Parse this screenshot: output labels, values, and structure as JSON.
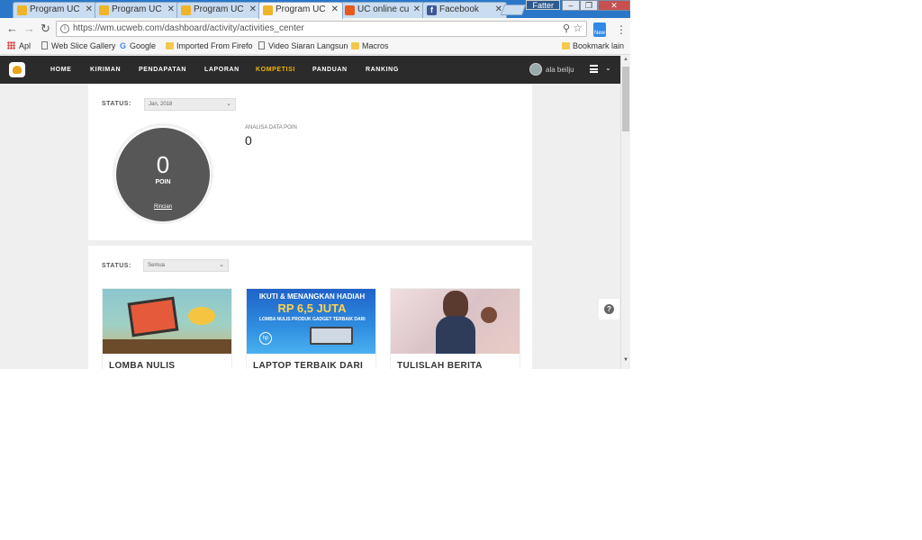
{
  "tabs": [
    {
      "label": "Program UC",
      "icon": "uc-favicon",
      "active": false
    },
    {
      "label": "Program UC",
      "icon": "uc-favicon",
      "active": false
    },
    {
      "label": "Program UC",
      "icon": "uc-favicon",
      "active": false
    },
    {
      "label": "Program UC",
      "icon": "uc-favicon",
      "active": true
    },
    {
      "label": "UC online cu",
      "icon": "uc-favicon",
      "active": false
    },
    {
      "label": "Facebook",
      "icon": "facebook-favicon",
      "active": false
    }
  ],
  "window": {
    "user": "Fatter"
  },
  "address": {
    "url": "https://wm.ucweb.com/dashboard/activity/activities_center"
  },
  "bookmarks": [
    {
      "label": "Apl",
      "icon": "apps-grid-icon"
    },
    {
      "label": "Web Slice Gallery",
      "icon": "page-icon"
    },
    {
      "label": "Google",
      "icon": "google-icon"
    },
    {
      "label": "Imported From Firefo",
      "icon": "folder-icon"
    },
    {
      "label": "Video Siaran Langsun",
      "icon": "page-icon"
    },
    {
      "label": "Macros",
      "icon": "folder-icon"
    },
    {
      "label": "Bookmark lain",
      "icon": "folder-icon"
    }
  ],
  "nav": {
    "items": [
      "HOME",
      "KIRIMAN",
      "PENDAPATAN",
      "LAPORAN",
      "KOMPETISI",
      "PANDUAN",
      "RANKING"
    ],
    "active": "KOMPETISI",
    "username": "ala beilju"
  },
  "points_card": {
    "status_label": "STATUS:",
    "status_value": "Jan, 2018",
    "points": "0",
    "points_unit": "POIN",
    "detail_link": "Rincian",
    "analysis_label": "ANALISA DATA POIN",
    "analysis_value": "0"
  },
  "competitions": {
    "status_label": "STATUS:",
    "status_value": "Semua",
    "cards": [
      {
        "title": "LOMBA NULIS"
      },
      {
        "title": "LAPTOP TERBAIK DARI",
        "banner_line1": "IKUTI & MENANGKAN HADIAH",
        "banner_line2": "RP 6,5 JUTA",
        "banner_line3": "LOMBA NULIS PRODUK GADGET TERBAIK DARI",
        "banner_brand": "hp"
      },
      {
        "title": "TULISLAH BERITA"
      }
    ]
  },
  "colors": {
    "accent": "#f5b400",
    "navbar": "#2b2b2b",
    "points_circle": "#575757"
  }
}
